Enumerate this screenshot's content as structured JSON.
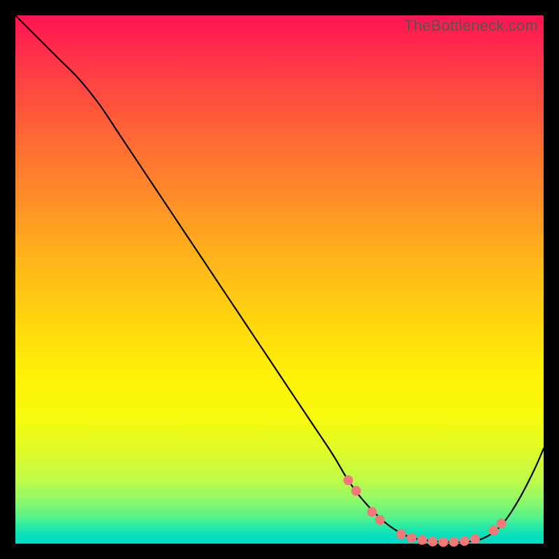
{
  "watermark": "TheBottleneck.com",
  "colors": {
    "frame_bg": "#000000",
    "line": "#000000",
    "marker_fill": "#ef7a77",
    "gradient_top": "#ff1453",
    "gradient_bottom": "#00d8c8"
  },
  "chart_data": {
    "type": "line",
    "title": "",
    "xlabel": "",
    "ylabel": "",
    "xlim": [
      0,
      100
    ],
    "ylim": [
      0,
      100
    ],
    "grid": false,
    "legend": false,
    "series": [
      {
        "name": "bottleneck-curve",
        "x": [
          0,
          4,
          8,
          12,
          16,
          20,
          24,
          28,
          32,
          36,
          40,
          44,
          48,
          52,
          56,
          60,
          63,
          66,
          70,
          74,
          78,
          82,
          86,
          89,
          92,
          95,
          98,
          100
        ],
        "y": [
          100,
          96,
          92,
          88,
          83,
          77,
          71,
          65,
          59,
          53,
          47,
          41,
          35,
          29,
          23,
          17,
          12,
          8,
          4,
          1.5,
          0.6,
          0.3,
          0.4,
          1.2,
          3.5,
          7.8,
          13.5,
          18
        ]
      }
    ],
    "markers": {
      "name": "highlighted-points",
      "points": [
        {
          "x": 63.0,
          "y": 12.0
        },
        {
          "x": 64.5,
          "y": 10.0
        },
        {
          "x": 67.5,
          "y": 6.0
        },
        {
          "x": 69.0,
          "y": 4.5
        },
        {
          "x": 73.0,
          "y": 1.8
        },
        {
          "x": 75.0,
          "y": 1.1
        },
        {
          "x": 77.0,
          "y": 0.7
        },
        {
          "x": 79.0,
          "y": 0.4
        },
        {
          "x": 81.0,
          "y": 0.3
        },
        {
          "x": 83.0,
          "y": 0.35
        },
        {
          "x": 85.0,
          "y": 0.5
        },
        {
          "x": 87.0,
          "y": 0.9
        },
        {
          "x": 90.5,
          "y": 2.5
        },
        {
          "x": 92.0,
          "y": 3.8
        }
      ]
    }
  }
}
